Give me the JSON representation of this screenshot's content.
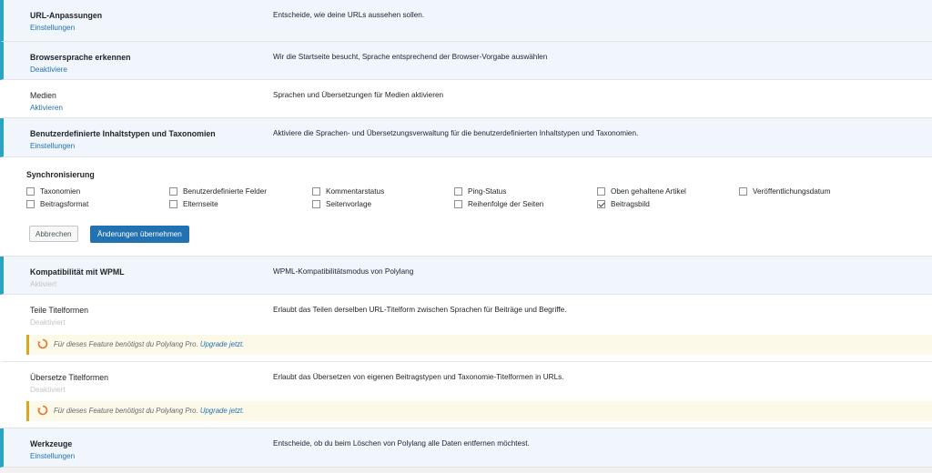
{
  "modules": [
    {
      "name": "URL-Anpassungen",
      "action": "Einstellungen",
      "description": "Entscheide, wie deine URLs aussehen sollen."
    },
    {
      "name": "Browsersprache erkennen",
      "action": "Deaktiviere",
      "description": "Wir die Startseite besucht, Sprache entsprechend der Browser-Vorgabe auswählen"
    },
    {
      "name": "Medien",
      "action": "Aktivieren",
      "description": "Sprachen und Übersetzungen für Medien aktivieren"
    },
    {
      "name": "Benutzerdefinierte Inhaltstypen und Taxonomien",
      "action": "Einstellungen",
      "description": "Aktiviere die Sprachen- und Übersetzungsverwaltung für die benutzerdefinierten Inhaltstypen und Taxonomien."
    },
    {
      "name": "Kompatibilität mit WPML",
      "action": "Aktiviert",
      "description": "WPML-Kompatibilitätsmodus von Polylang"
    },
    {
      "name": "Teile Titelformen",
      "action": "Deaktiviert",
      "description": "Erlaubt das Teilen derselben URL-Titelform zwischen Sprachen für Beiträge und Begriffe."
    },
    {
      "name": "Übersetze Titelformen",
      "action": "Deaktiviert",
      "description": "Erlaubt das Übersetzen von eigenen Beitragstypen und Taxonomie-Titelformen in URLs."
    },
    {
      "name": "Werkzeuge",
      "action": "Einstellungen",
      "description": "Entscheide, ob du beim Löschen von Polylang alle Daten entfernen möchtest."
    }
  ],
  "sync": {
    "title": "Synchronisierung",
    "options": [
      {
        "label": "Taxonomien",
        "checked": false
      },
      {
        "label": "Benutzerdefinierte Felder",
        "checked": false
      },
      {
        "label": "Kommentarstatus",
        "checked": false
      },
      {
        "label": "Ping-Status",
        "checked": false
      },
      {
        "label": "Oben gehaltene Artikel",
        "checked": false
      },
      {
        "label": "Veröffentlichungsdatum",
        "checked": false
      },
      {
        "label": "Beitragsformat",
        "checked": false
      },
      {
        "label": "Elternseite",
        "checked": false
      },
      {
        "label": "Seitenvorlage",
        "checked": false
      },
      {
        "label": "Reihenfolge der Seiten",
        "checked": false
      },
      {
        "label": "Beitragsbild",
        "checked": true
      }
    ],
    "cancel_label": "Abbrechen",
    "save_label": "Änderungen übernehmen"
  },
  "notice": {
    "text": "Für dieses Feature benötigst du Polylang Pro.",
    "link": "Upgrade jetzt.",
    "icon": "refresh-icon",
    "color": "#dba617"
  },
  "colors": {
    "accent": "#2aa4c0",
    "link": "#2271b1",
    "button": "#2271b1"
  }
}
